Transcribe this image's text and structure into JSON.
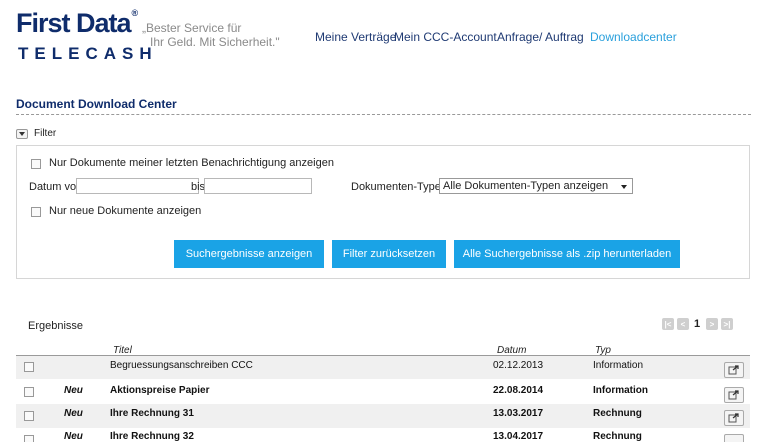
{
  "brand": {
    "top": "First Data",
    "reg": "®",
    "bottom": "TELECASH",
    "slogan_line1": "„Bester Service für",
    "slogan_line2": "Ihr Geld. Mit Sicherheit.\""
  },
  "nav": {
    "items": [
      {
        "label": "Meine Verträge"
      },
      {
        "label": "Mein CCC-Account"
      },
      {
        "label": "Anfrage/ Auftrag"
      },
      {
        "label": "Downloadcenter"
      }
    ]
  },
  "page": {
    "title": "Document Download Center"
  },
  "filter": {
    "toggle_label": "Filter",
    "last_notification_label": "Nur Dokumente meiner letzten Benachrichtigung anzeigen",
    "date_from_label": "Datum von",
    "date_to_label": "bis",
    "doc_types_label": "Dokumenten-Typen",
    "doc_types_selected": "Alle Dokumenten-Typen anzeigen",
    "only_new_label": "Nur neue Dokumente anzeigen",
    "date_from_value": "",
    "date_to_value": "",
    "buttons": {
      "show": "Suchergebnisse anzeigen",
      "reset": "Filter zurücksetzen",
      "download_zip": "Alle Suchergebnisse als .zip herunterladen"
    }
  },
  "results": {
    "label": "Ergebnisse",
    "pager": {
      "first": "|<",
      "prev": "<",
      "current": "1",
      "next": ">",
      "last": ">|"
    },
    "columns": {
      "title": "Titel",
      "date": "Datum",
      "type": "Typ"
    },
    "rows": [
      {
        "new": "",
        "title": "Begruessungsanschreiben CCC",
        "date": "02.12.2013",
        "type": "Information"
      },
      {
        "new": "Neu",
        "title": "Aktionspreise Papier",
        "date": "22.08.2014",
        "type": "Information"
      },
      {
        "new": "Neu",
        "title": "Ihre Rechnung 31",
        "date": "13.03.2017",
        "type": "Rechnung"
      },
      {
        "new": "Neu",
        "title": "Ihre Rechnung 32",
        "date": "13.04.2017",
        "type": "Rechnung"
      }
    ]
  },
  "colors": {
    "brand": "#0f2c6b",
    "accent": "#1aa3e6",
    "nav_active": "#2aa0dc"
  },
  "icons": {
    "filter_toggle": "chevron-down-icon",
    "open_doc": "external-link-icon"
  }
}
